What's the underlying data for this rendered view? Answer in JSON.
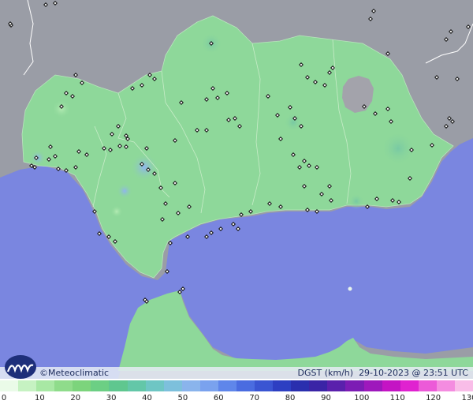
{
  "brand": {
    "name": "Meteoclimatic",
    "logo_icon": "meteoclimatic-logo-icon",
    "copyright_symbol": "©"
  },
  "caption": {
    "variable": "DGST (km/h)",
    "datetime": "29-10-2023 @ 23:51 UTC"
  },
  "legend": {
    "ticks": [
      "0",
      "10",
      "20",
      "30",
      "40",
      "50",
      "60",
      "70",
      "80",
      "90",
      "100",
      "110",
      "120",
      "130"
    ],
    "min": 0,
    "max": 130,
    "colors": [
      "#eafbe8",
      "#c6f2c2",
      "#a8e8a4",
      "#8fdc8b",
      "#7cd47c",
      "#6ccf84",
      "#5fc78f",
      "#63c7a8",
      "#6ec6c4",
      "#7dc0dc",
      "#8ab4ec",
      "#7aa2ee",
      "#5f86ea",
      "#4a6ce0",
      "#3a55d2",
      "#2d3fc2",
      "#2a2fae",
      "#3a24a6",
      "#5a20ac",
      "#7c1cb4",
      "#9e18bc",
      "#c414c4",
      "#e022d0",
      "#ec5ad8",
      "#f48ce0",
      "#f9bde8"
    ]
  },
  "map_colors": {
    "sea": "#7a86e0",
    "land_other": "#9a9da6",
    "andalucia": "#8ed89a",
    "africa": "#8ed89a",
    "stations": "#111111"
  }
}
